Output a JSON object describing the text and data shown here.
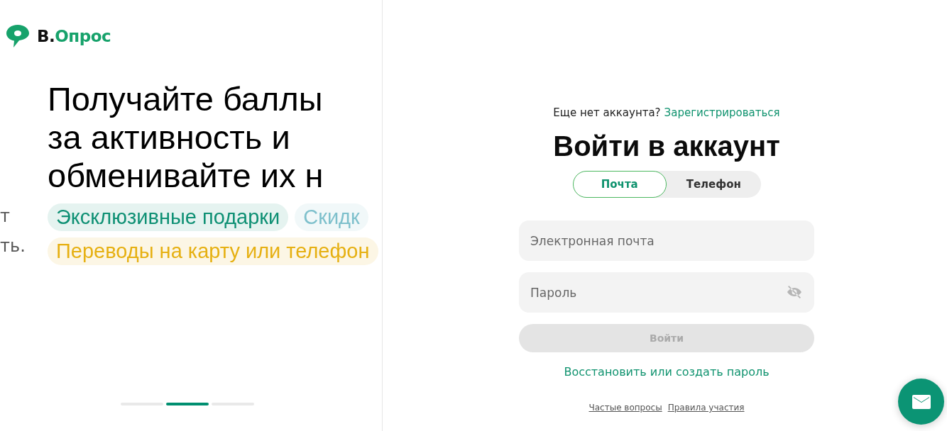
{
  "logo": {
    "prefix": "В.",
    "name": "Опрос"
  },
  "promo": {
    "prev_fragments": [
      "т",
      "ть."
    ],
    "headline": [
      "Получайте баллы",
      "за активность и",
      "обменивайте их н"
    ],
    "chips": [
      {
        "label": "Эксклюзивные подарки",
        "color": "#0e9074"
      },
      {
        "label": "Скидк",
        "color": "#7ec0cc"
      },
      {
        "label": "Переводы на карту или телефон",
        "color": "#e6b012"
      }
    ],
    "slides": [
      {
        "selected": false
      },
      {
        "selected": true
      },
      {
        "selected": false
      }
    ]
  },
  "signup": {
    "question": "Еще нет аккаунта?",
    "link": "Зарегистрироваться"
  },
  "title": "Войти в аккаунт",
  "tabs": [
    {
      "label": "Почта",
      "selected": true
    },
    {
      "label": "Телефон",
      "selected": false
    }
  ],
  "email": {
    "placeholder": "Электронная почта"
  },
  "password": {
    "placeholder": "Пароль"
  },
  "submit": {
    "label": "Войти",
    "disabled": true
  },
  "restore_link": "Восстановить или создать пароль",
  "footer_links": [
    "Частые вопросы",
    "Правила участия"
  ]
}
